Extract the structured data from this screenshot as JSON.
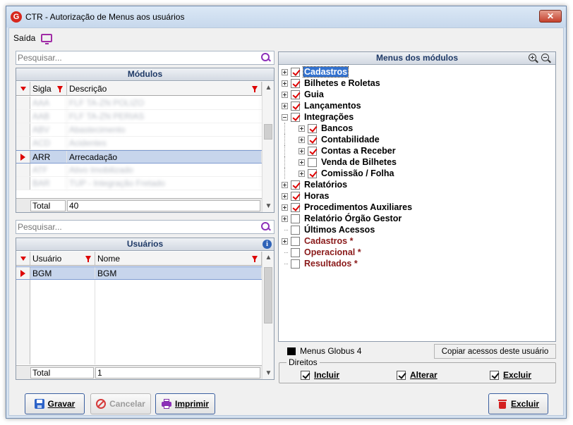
{
  "window": {
    "title": "CTR - Autorização de Menus aos usuários",
    "icon_letter": "G",
    "close": "✕"
  },
  "menu": {
    "saida": "Saída"
  },
  "modulos": {
    "search_placeholder": "Pesquisar...",
    "title": "Módulos",
    "columns": {
      "sigla": "Sigla",
      "descricao": "Descrição"
    },
    "rows": [
      {
        "sigla": "AAA",
        "descricao": "FLF  TA-ZN  POLIZO",
        "blurred": true
      },
      {
        "sigla": "AAB",
        "descricao": "FLF  TA-ZN  PERIAS",
        "blurred": true
      },
      {
        "sigla": "ABV",
        "descricao": "Abastecimento",
        "blurred": true
      },
      {
        "sigla": "ACD",
        "descricao": "Acidentes",
        "blurred": true
      },
      {
        "sigla": "ARR",
        "descricao": "Arrecadação",
        "blurred": false,
        "selected": true
      },
      {
        "sigla": "ATF",
        "descricao": "Ativo Imobilizado",
        "blurred": true
      },
      {
        "sigla": "BAR",
        "descricao": "TUP - Integração Fretado",
        "blurred": true
      }
    ],
    "total_label": "Total",
    "total_value": "40"
  },
  "usuarios": {
    "search_placeholder": "Pesquisar...",
    "title": "Usuários",
    "info_icon": "i",
    "columns": {
      "usuario": "Usuário",
      "nome": "Nome"
    },
    "rows": [
      {
        "usuario": "BGM",
        "nome": "BGM"
      }
    ],
    "total_label": "Total",
    "total_value": "1"
  },
  "menus": {
    "title": "Menus dos módulos",
    "tree": [
      {
        "label": "Cadastros",
        "level": 0,
        "checked": true,
        "expander": "plus",
        "focus": true
      },
      {
        "label": "Bilhetes e Roletas",
        "level": 0,
        "checked": true,
        "expander": "plus"
      },
      {
        "label": "Guia",
        "level": 0,
        "checked": true,
        "expander": "plus"
      },
      {
        "label": "Lançamentos",
        "level": 0,
        "checked": true,
        "expander": "plus"
      },
      {
        "label": "Integrações",
        "level": 0,
        "checked": true,
        "expander": "minus"
      },
      {
        "label": "Bancos",
        "level": 1,
        "checked": true,
        "expander": "plus"
      },
      {
        "label": "Contabilidade",
        "level": 1,
        "checked": true,
        "expander": "plus"
      },
      {
        "label": "Contas a Receber",
        "level": 1,
        "checked": true,
        "expander": "plus"
      },
      {
        "label": "Venda de Bilhetes",
        "level": 1,
        "checked": false,
        "expander": "plus"
      },
      {
        "label": "Comissão / Folha",
        "level": 1,
        "checked": true,
        "expander": "plus"
      },
      {
        "label": "Relatórios",
        "level": 0,
        "checked": true,
        "expander": "plus"
      },
      {
        "label": "Horas",
        "level": 0,
        "checked": true,
        "expander": "plus"
      },
      {
        "label": "Procedimentos Auxiliares",
        "level": 0,
        "checked": true,
        "expander": "plus"
      },
      {
        "label": "Relatório Órgão Gestor",
        "level": 0,
        "checked": false,
        "expander": "plus"
      },
      {
        "label": "Últimos Acessos",
        "level": 0,
        "checked": false,
        "expander": "none"
      },
      {
        "label": "Cadastros *",
        "level": 0,
        "checked": false,
        "expander": "plus",
        "maroon": true
      },
      {
        "label": "Operacional *",
        "level": 0,
        "checked": false,
        "expander": "none",
        "maroon": true
      },
      {
        "label": "Resultados *",
        "level": 0,
        "checked": false,
        "expander": "none",
        "maroon": true
      }
    ],
    "legend": "Menus Globus 4",
    "copy_button": "Copiar acessos deste usuário"
  },
  "direitos": {
    "label": "Direitos",
    "incluir": "Incluir",
    "alterar": "Alterar",
    "excluir": "Excluir"
  },
  "buttons": {
    "gravar": "Gravar",
    "cancelar": "Cancelar",
    "imprimir": "Imprimir",
    "excluir": "Excluir"
  },
  "colors": {
    "check": "#dd0000",
    "selection": "#c7d5ec",
    "focus": "#3372cf",
    "maroon": "#8a1a1a"
  }
}
